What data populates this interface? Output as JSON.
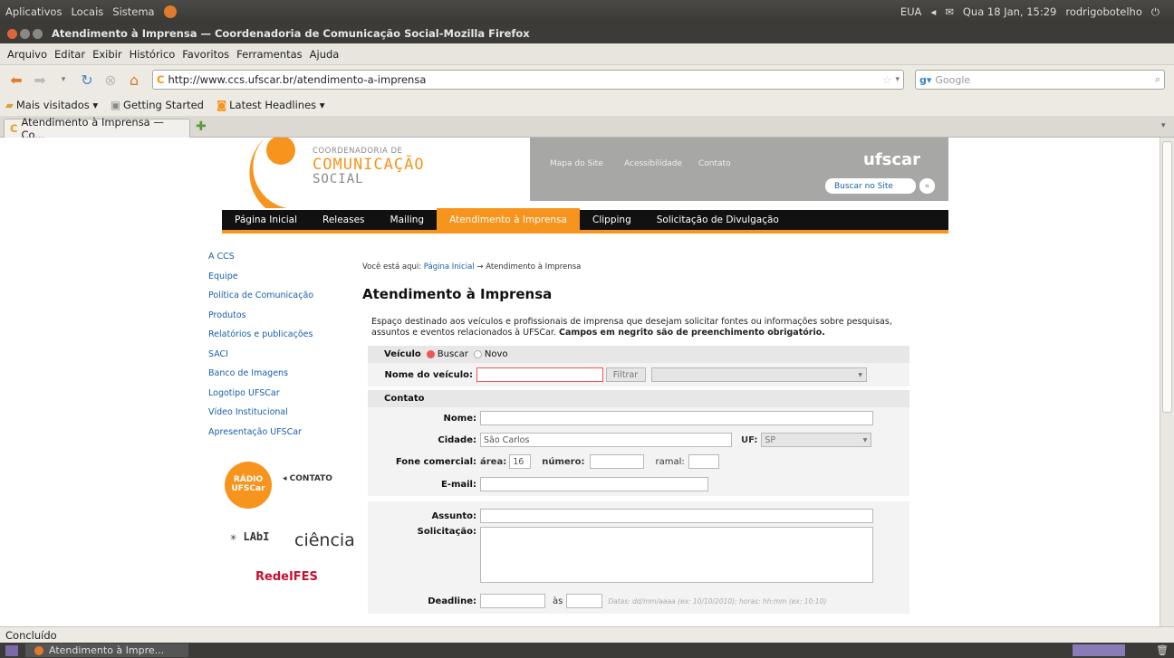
{
  "system": {
    "menus": [
      "Aplicativos",
      "Locais",
      "Sistema"
    ],
    "keyboard": "EUA",
    "datetime": "Qua 18 Jan, 15:29",
    "user": "rodrigobotelho"
  },
  "window": {
    "title": "Atendimento à Imprensa — Coordenadoria de Comunicação Social-Mozilla Firefox"
  },
  "menubar": [
    "Arquivo",
    "Editar",
    "Exibir",
    "Histórico",
    "Favoritos",
    "Ferramentas",
    "Ajuda"
  ],
  "navbar": {
    "url": "http://www.ccs.ufscar.br/atendimento-a-imprensa",
    "search_placeholder": "Google"
  },
  "bookmarks": [
    "Mais visitados ▾",
    "Getting Started",
    "Latest Headlines ▾"
  ],
  "tab": {
    "label": "Atendimento à Imprensa — Co..."
  },
  "status": "Concluído",
  "taskbar": {
    "item": "Atendimento à Impre..."
  },
  "site": {
    "logo_line1": "COORDENADORIA DE",
    "logo_line2": "COMUNICAÇÃO",
    "logo_line3": "SOCIAL",
    "top_links": [
      "Mapa do Site",
      "Acessibilidade",
      "Contato"
    ],
    "ufscar": "ufscar",
    "search_label": "Buscar no Site",
    "nav": [
      "Página Inicial",
      "Releases",
      "Mailing",
      "Atendimento à Imprensa",
      "Clipping",
      "Solicitação de Divulgação"
    ],
    "sidenav": [
      "A CCS",
      "Equipe",
      "Política de Comunicação",
      "Produtos",
      "Relatórios e publicações",
      "SACI",
      "Banco de Imagens",
      "Logotipo UFSCar",
      "Vídeo Institucional",
      "Apresentação UFSCar"
    ],
    "breadcrumb_prefix": "Você está aqui:",
    "breadcrumb_link": "Página Inicial",
    "breadcrumb_sep": "→",
    "breadcrumb_current": "Atendimento à Imprensa",
    "page_title": "Atendimento à Imprensa",
    "intro": "Espaço destinado aos veículos e profissionais de imprensa que desejam solicitar fontes ou informações sobre pesquisas, assuntos e eventos relacionados à UFSCar.",
    "intro_bold": "Campos em negrito são de preenchimento obrigatório.",
    "logos": {
      "radio": "RÁDIO UFSCar",
      "contato": "CONTATO",
      "labi": "LAbI",
      "ciencia": "ciência",
      "redeifes": "RedeIFES"
    }
  },
  "form": {
    "veiculo_label": "Veículo",
    "radio_buscar": "Buscar",
    "radio_novo": "Novo",
    "nome_veiculo_label": "Nome do veículo:",
    "filtrar_label": "Filtrar",
    "contato_section": "Contato",
    "nome_label": "Nome:",
    "cidade_label": "Cidade:",
    "cidade_value": "São Carlos",
    "uf_label": "UF:",
    "uf_value": "SP",
    "fone_label": "Fone comercial:",
    "area_label": "área:",
    "area_value": "16",
    "numero_label": "número:",
    "ramal_label": "ramal:",
    "email_label": "E-mail:",
    "assunto_label": "Assunto:",
    "solicitacao_label": "Solicitação:",
    "deadline_label": "Deadline:",
    "as_label": "às",
    "deadline_hint": "Datas: dd/mm/aaaa (ex: 10/10/2010); horas: hh:mm (ex: 10:10)"
  },
  "colors": {
    "accent": "#f7941d",
    "link": "#1a5ea8",
    "nav_bg": "#111111"
  }
}
